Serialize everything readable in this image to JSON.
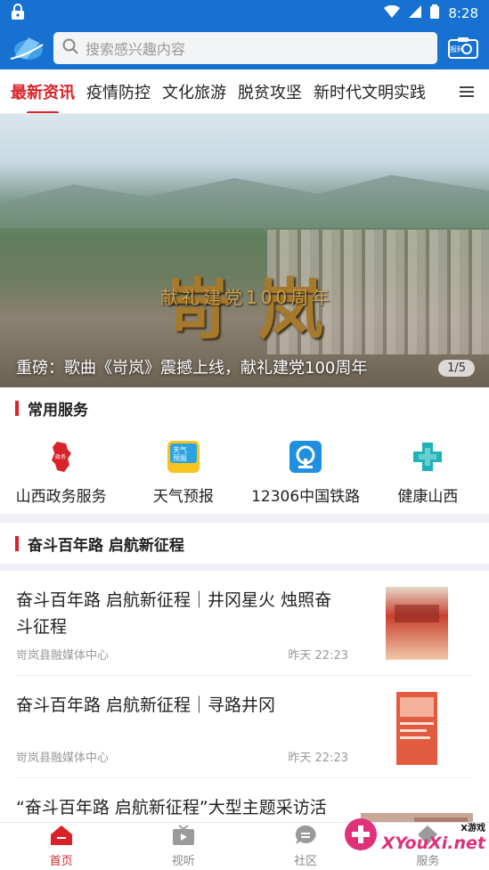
{
  "status_bar": {
    "time": "8:28"
  },
  "search": {
    "placeholder": "搜索感兴趣内容"
  },
  "header": {
    "right_icon": "baoliao-camera-icon",
    "right_label": "报料"
  },
  "tabs": [
    "最新资讯",
    "疫情防控",
    "文化旅游",
    "脱贫攻坚",
    "新时代文明实践"
  ],
  "banner": {
    "caption": "重磅：歌曲《岢岚》震撼上线，献礼建党100周年",
    "pager": "1/5",
    "calligraphy": "岢岚",
    "subtitle": "献礼建党100周年"
  },
  "services": {
    "title": "常用服务",
    "items": [
      {
        "label": "山西政务服务",
        "icon": "shanxi-map-icon"
      },
      {
        "label": "天气预报",
        "icon": "weather-icon"
      },
      {
        "label": "12306中国铁路",
        "icon": "railway-icon"
      },
      {
        "label": "健康山西",
        "icon": "health-cross-icon"
      }
    ]
  },
  "feature": {
    "title": "奋斗百年路 启航新征程"
  },
  "news": [
    {
      "title": "奋斗百年路 启航新征程｜井冈星火 烛照奋斗征程",
      "source": "岢岚县融媒体中心",
      "time": "昨天 22:23"
    },
    {
      "title": "奋斗百年路 启航新征程｜寻路井冈",
      "source": "岢岚县融媒体中心",
      "time": "昨天 22:23"
    },
    {
      "title": "“奋斗百年路 启航新征程”大型主题采访活",
      "source": "",
      "time": ""
    }
  ],
  "tabbar": [
    {
      "label": "首页",
      "icon": "home-icon"
    },
    {
      "label": "视听",
      "icon": "tv-icon"
    },
    {
      "label": "社区",
      "icon": "chat-icon"
    },
    {
      "label": "服务",
      "icon": "service-icon"
    }
  ],
  "watermark": {
    "text": "XYouXi.net",
    "small": "X游戏"
  },
  "colors": {
    "primary": "#1771d0",
    "accent": "#d9232a"
  }
}
